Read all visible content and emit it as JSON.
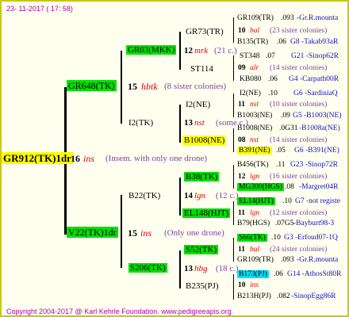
{
  "date": "23- 11-2017 ( 17: 58)",
  "footer": "Copyright 2004-2017 @ Karl Kehrle Foundation.   www.pedigreeapis.org",
  "root": {
    "name": "GR912(TK)1dr",
    "num": "16",
    "race": "ins",
    "note": "(Insem. with only one drone)"
  },
  "g1": [
    {
      "name": "GR648(TK)",
      "num": "15",
      "race": "hbtk",
      "note": "(8 sister colonies)"
    },
    {
      "name": "V22(TK)1dr",
      "num": "15",
      "race": "ins",
      "note": "(Only one drone)"
    }
  ],
  "g2": [
    {
      "name": "GR03(MKK)",
      "num": "12",
      "race": "mrk",
      "note": "(21 c.)"
    },
    {
      "name": "I2(TK)",
      "num": "13",
      "race": "nst",
      "note": "(some c.)"
    },
    {
      "name": "B22(TK)",
      "num": "14",
      "race": "lgn",
      "note": "(12 c.)"
    },
    {
      "name": "S206(TK)",
      "num": "13",
      "race": "hbg",
      "note": "(18 c.)"
    }
  ],
  "g3": [
    {
      "name": "GR73(TR)",
      "num": "10",
      "race": "bal",
      "note": "(23 sister colonies)"
    },
    {
      "name": "ST114",
      "num": "09",
      "race": "alr",
      "note": "(14 sister colonies)"
    },
    {
      "name": "I2(NE)",
      "num": "11",
      "race": "nst",
      "note": "(10 sister colonies)"
    },
    {
      "name": "B1008(NE)",
      "num": "08",
      "race": "nst",
      "note": "(14 sister colonies)"
    },
    {
      "name": "B38(TK)",
      "num": "12",
      "race": "lgn",
      "note": "(16 sister colonies)"
    },
    {
      "name": "EL148(HJT)",
      "num": "11",
      "race": "lgn",
      "note": "(12 sister colonies)"
    },
    {
      "name": "S52(TK)",
      "num": "11",
      "race": "bal",
      "note": "(24 sister colonies)"
    },
    {
      "name": "B235(PJ)",
      "num": "10",
      "race": "ins",
      "note": ""
    }
  ],
  "g4": [
    {
      "name": "GR109(TR)",
      "mid": ".093",
      "right": "-Gr.R.mounta"
    },
    {
      "name": "B135(TR)",
      "mid": ".06",
      "right": "G8 -Takab93aR"
    },
    {
      "name": "ST348",
      "mid": ".07",
      "right": "G21 -Sinop62R"
    },
    {
      "name": "KB080",
      "mid": ".06",
      "right": "G4 -Carpath00R"
    },
    {
      "name": "I2(NE)",
      "mid": ".10",
      "right": "G6 -SardiniaQ"
    },
    {
      "name": "B1003(NE)",
      "mid": ".09",
      "right": "G5 -B1003(NE)"
    },
    {
      "name": "B1008(NE)",
      "mid": ".0G31",
      "right": "-B1008a(NE)"
    },
    {
      "name": "B391(NE)",
      "mid": ".05",
      "right": "G6 -B391(NE)"
    },
    {
      "name": "B456(TK)",
      "mid": ".11",
      "right": "G23 -Sinop72R"
    },
    {
      "name": "MG300(HGS)",
      "mid": ".08",
      "right": "-Margret04R"
    },
    {
      "name": "EL14(HJT)",
      "mid": ".10",
      "right": "G7 -not registe"
    },
    {
      "name": "B79(HGS)",
      "mid": ".07G5",
      "right": "-Bayburt98-3"
    },
    {
      "name": "S66(TK)",
      "mid": ".10",
      "right": "G3 -Erfoud07-1Q"
    },
    {
      "name": "GR109(TR)",
      "mid": ".093",
      "right": "-Gr.R.mounta"
    },
    {
      "name": "B173(PJ)",
      "mid": ".06",
      "right": "G14 -AthosSt80R"
    },
    {
      "name": "B213H(PJ)",
      "mid": ".082",
      "right": "-SinopEgg86R"
    }
  ]
}
